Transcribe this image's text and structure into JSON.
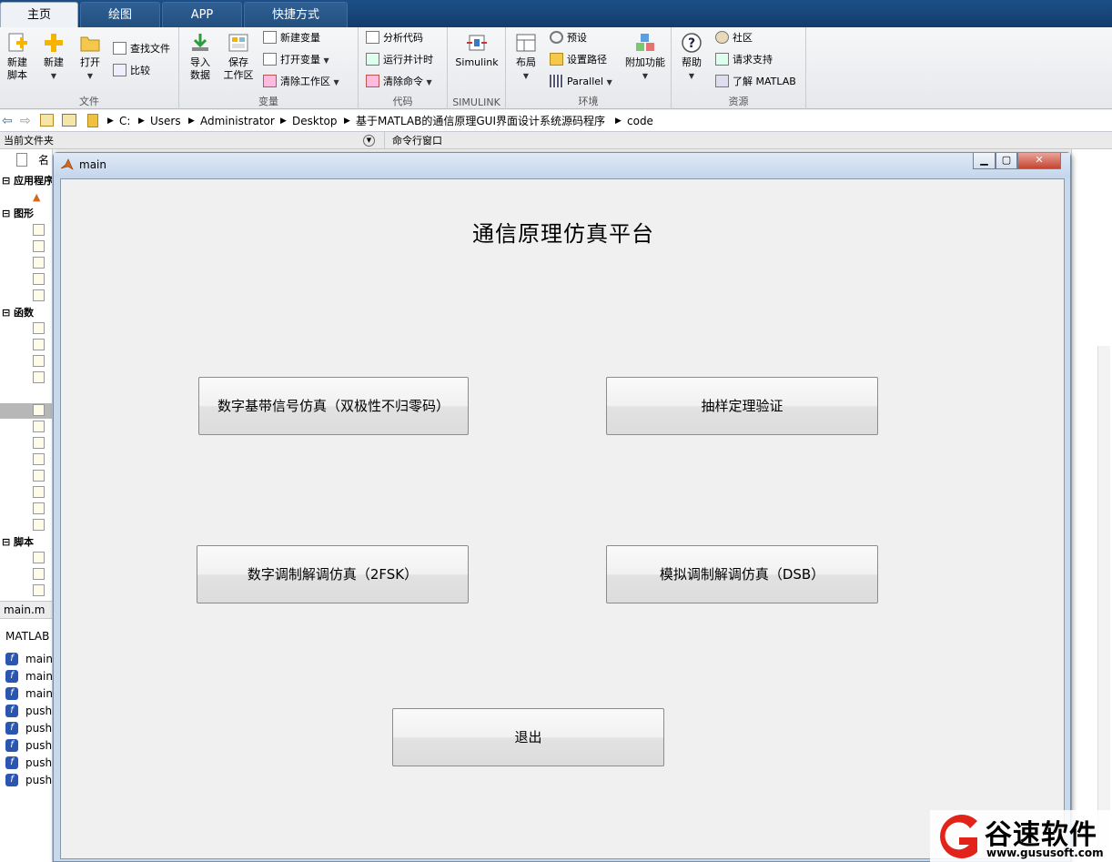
{
  "tabs": [
    {
      "label": "主页",
      "active": true
    },
    {
      "label": "绘图",
      "active": false
    },
    {
      "label": "APP",
      "active": false
    },
    {
      "label": "快捷方式",
      "active": false
    }
  ],
  "ribbon": {
    "file": {
      "new_script": [
        "新建",
        "脚本"
      ],
      "new": "新建",
      "open": "打开",
      "find_files": "查找文件",
      "compare": "比较",
      "label": "文件"
    },
    "variable": {
      "import": [
        "导入",
        "数据"
      ],
      "save_workspace": [
        "保存",
        "工作区"
      ],
      "new_variable": "新建变量",
      "open_variable": "打开变量",
      "clear_workspace": "清除工作区",
      "label": "变量"
    },
    "code": {
      "analyze": "分析代码",
      "run_time": "运行并计时",
      "clear_commands": "清除命令",
      "label": "代码"
    },
    "simulink": {
      "button": "Simulink",
      "label": "SIMULINK"
    },
    "environment": {
      "layout": "布局",
      "preferences": "预设",
      "set_path": "设置路径",
      "parallel": "Parallel",
      "addons": "附加功能",
      "label": "环境"
    },
    "resources": {
      "help": "帮助",
      "community": "社区",
      "request_support": "请求支持",
      "learn_matlab": "了解 MATLAB",
      "label": "资源"
    }
  },
  "path": [
    "C:",
    "Users",
    "Administrator",
    "Desktop",
    "基于MATLAB的通信原理GUI界面设计系统源码程序",
    "code"
  ],
  "panels": {
    "current_folder": "当前文件夹",
    "command_window": "命令行窗口",
    "name_col": "名"
  },
  "left_tree": {
    "sections": [
      "应用程序",
      "图形",
      "函数",
      "脚本"
    ],
    "detail_file": "main.m",
    "workspace_title": "MATLAB",
    "workspace_items": [
      "main",
      "main_",
      "main_",
      "push",
      "push",
      "push",
      "push",
      "push"
    ]
  },
  "figure": {
    "title": "main",
    "heading": "通信原理仿真平台",
    "buttons": {
      "baseband": "数字基带信号仿真（双极性不归零码）",
      "sampling": "抽样定理验证",
      "fsk": "数字调制解调仿真（2FSK）",
      "dsb": "模拟调制解调仿真（DSB）",
      "exit": "退出"
    }
  },
  "watermark": {
    "brand": "谷速软件",
    "url": "www.gususoft.com"
  }
}
